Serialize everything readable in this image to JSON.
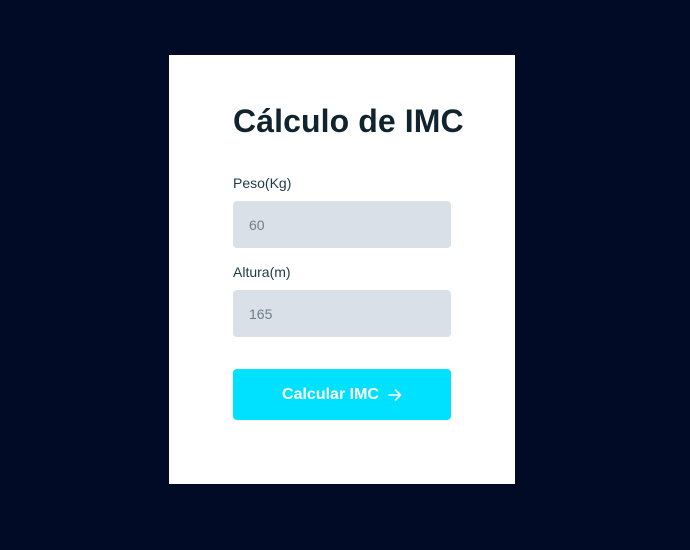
{
  "colors": {
    "background": "#020b26",
    "card": "#ffffff",
    "title": "#10242f",
    "input_bg": "#dae0e8",
    "button": "#00e1ff",
    "button_text": "#ffffff"
  },
  "form": {
    "title": "Cálculo de IMC",
    "peso": {
      "label": "Peso(Kg)",
      "placeholder": "60",
      "value": ""
    },
    "altura": {
      "label": "Altura(m)",
      "placeholder": "165",
      "value": ""
    },
    "submit": {
      "label": "Calcular IMC",
      "icon": "arrow-right-icon"
    }
  }
}
